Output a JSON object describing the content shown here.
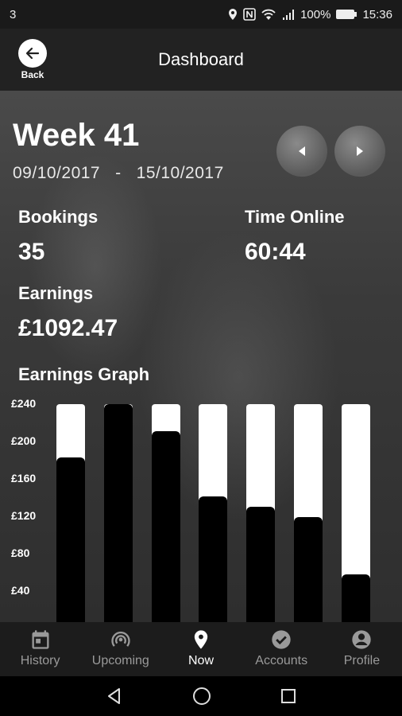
{
  "status": {
    "left": "3",
    "battery": "100%",
    "time": "15:36"
  },
  "header": {
    "back_label": "Back",
    "title": "Dashboard"
  },
  "week": {
    "title": "Week 41",
    "start": "09/10/2017",
    "separator": "-",
    "end": "15/10/2017"
  },
  "stats": {
    "bookings_label": "Bookings",
    "bookings_value": "35",
    "time_online_label": "Time Online",
    "time_online_value": "60:44",
    "earnings_label": "Earnings",
    "earnings_value": "£1092.47"
  },
  "graph_title": "Earnings Graph",
  "chart_data": {
    "type": "bar",
    "title": "Earnings Graph",
    "y_tick_labels": [
      "£240",
      "£200",
      "£160",
      "£120",
      "£80",
      "£40"
    ],
    "ylim": [
      0,
      240
    ],
    "values": [
      183,
      240,
      211,
      141,
      130,
      119,
      58
    ],
    "grid": false
  },
  "bottom_nav": {
    "items": [
      {
        "label": "History",
        "icon": "calendar-icon"
      },
      {
        "label": "Upcoming",
        "icon": "broadcast-icon"
      },
      {
        "label": "Now",
        "icon": "location-pin-icon"
      },
      {
        "label": "Accounts",
        "icon": "check-circle-icon"
      },
      {
        "label": "Profile",
        "icon": "account-circle-icon"
      }
    ],
    "active": "Now"
  },
  "colors": {
    "app_bar": "#222222",
    "bar_background": "#ffffff",
    "bar_fill": "#000000",
    "nav_active": "#ffffff",
    "nav_inactive": "#9a9a9a"
  }
}
